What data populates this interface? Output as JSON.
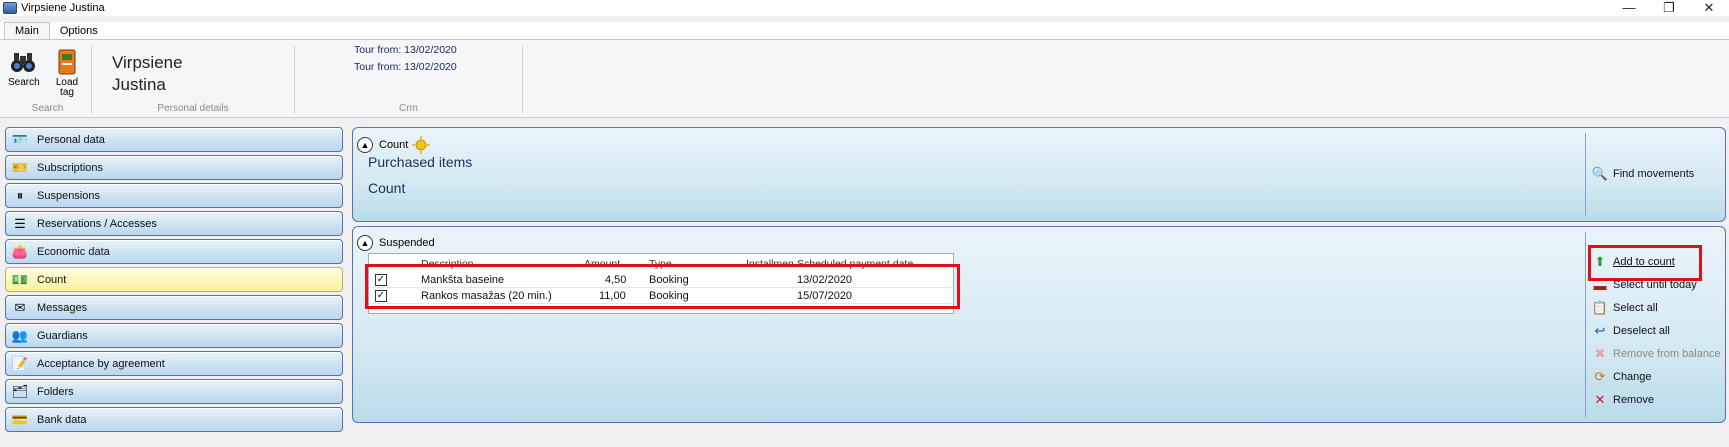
{
  "window": {
    "title": "Virpsiene Justina",
    "controls": [
      "—",
      "❐",
      "✕"
    ]
  },
  "tabs": [
    {
      "label": "Main"
    },
    {
      "label": "Options"
    }
  ],
  "ribbon": {
    "search_label": "Search",
    "load_tag_label": "Load tag",
    "search_group_label": "Search",
    "person_name": "Virpsiene Justina",
    "personal_group_label": "Personal details",
    "crm_lines": [
      "Tour from: 13/02/2020",
      "Tour from: 13/02/2020"
    ],
    "crm_group_label": "Crm"
  },
  "sidebar": {
    "items": [
      {
        "label": "Personal data",
        "icon": "id-card-icon"
      },
      {
        "label": "Subscriptions",
        "icon": "ticket-icon"
      },
      {
        "label": "Suspensions",
        "icon": "pause-card-icon"
      },
      {
        "label": "Reservations / Accesses",
        "icon": "list-icon"
      },
      {
        "label": "Economic data",
        "icon": "wallet-icon"
      },
      {
        "label": "Count",
        "icon": "money-icon"
      },
      {
        "label": "Messages",
        "icon": "message-icon"
      },
      {
        "label": "Guardians",
        "icon": "people-icon"
      },
      {
        "label": "Acceptance by agreement",
        "icon": "agreement-icon"
      },
      {
        "label": "Folders",
        "icon": "folder-icon"
      },
      {
        "label": "Bank data",
        "icon": "bank-icon"
      }
    ],
    "active_index": 5
  },
  "count_panel": {
    "header": "Count",
    "line1": "Purchased items",
    "line2": "Count",
    "find_movements": "Find movements"
  },
  "suspended_panel": {
    "header": "Suspended",
    "columns": [
      "Description",
      "Amount",
      "Type",
      "Installmen",
      "Scheduled payment date"
    ],
    "rows": [
      {
        "checked": true,
        "description": "Mankšta baseine",
        "amount": "4,50",
        "type": "Booking",
        "installment": "",
        "date": "13/02/2020"
      },
      {
        "checked": true,
        "description": "Rankos masažas (20 min.)",
        "amount": "11,00",
        "type": "Booking",
        "installment": "",
        "date": "15/07/2020"
      }
    ],
    "actions": [
      {
        "label": "Add to count",
        "enabled": true
      },
      {
        "label": "Select until today",
        "enabled": true
      },
      {
        "label": "Select all",
        "enabled": true
      },
      {
        "label": "Deselect all",
        "enabled": true
      },
      {
        "label": "Remove from balance",
        "enabled": false
      },
      {
        "label": "Change",
        "enabled": true
      },
      {
        "label": "Remove",
        "enabled": true
      }
    ]
  },
  "colors": {
    "highlight_red": "#e0101a",
    "active_yellow": "#fbf29a",
    "panel_blue": "#d5e9f3"
  }
}
